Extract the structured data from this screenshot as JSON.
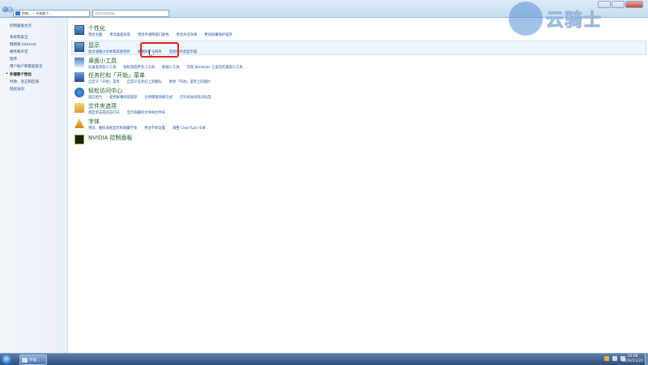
{
  "window": {
    "breadcrumb": [
      "控制...",
      "外观和个..."
    ],
    "search_placeholder": "搜索控制面板"
  },
  "watermark": {
    "text": "云骑士"
  },
  "sidebar": {
    "items": [
      {
        "label": "控制面板主页",
        "active": false
      },
      {
        "label": "系统和安全",
        "active": false
      },
      {
        "label": "网络和 Internet",
        "active": false
      },
      {
        "label": "硬件和声音",
        "active": false
      },
      {
        "label": "程序",
        "active": false
      },
      {
        "label": "用户帐户和家庭安全",
        "active": false
      },
      {
        "label": "外观和个性化",
        "active": true
      },
      {
        "label": "时钟、语言和区域",
        "active": false
      },
      {
        "label": "轻松访问",
        "active": false
      }
    ]
  },
  "categories": [
    {
      "title": "个性化",
      "icon": "monitor-icon",
      "links": [
        "更改主题",
        "更改桌面背景",
        "更改半透明窗口颜色",
        "更改声音效果",
        "更改屏幕保护程序"
      ]
    },
    {
      "title": "显示",
      "icon": "monitor-icon",
      "links": [
        "放大或缩小文本和其他项目",
        "调整屏幕分辨率",
        "连接到外部显示器"
      ]
    },
    {
      "title": "桌面小工具",
      "icon": "gadget-icon",
      "links": [
        "向桌面添加小工具",
        "联机获取更多小工具",
        "卸载小工具",
        "还原 Windows 上安装的桌面小工具"
      ]
    },
    {
      "title": "任务栏和「开始」菜单",
      "icon": "taskbar-icon",
      "links": [
        "自定义「开始」菜单",
        "自定义任务栏上的图标",
        "更改「开始」菜单上的图片"
      ]
    },
    {
      "title": "轻松访问中心",
      "icon": "ease-of-access-icon",
      "links": [
        "适应视力",
        "使用屏幕阅读程序",
        "启用键盘快捷方式",
        "打开或关闭高对比度"
      ]
    },
    {
      "title": "文件夹选项",
      "icon": "folder-icon",
      "links": [
        "指定单击或双击打开",
        "显示隐藏的文件和文件夹"
      ]
    },
    {
      "title": "字体",
      "icon": "font-icon",
      "links": [
        "预览、删除或者显示和隐藏字体",
        "更改字体设置",
        "调整 ClearType 文本"
      ]
    },
    {
      "title": "NVIDIA 控制面板",
      "icon": "nvidia-icon",
      "links": []
    }
  ],
  "taskbar": {
    "window_button": "外观...",
    "time": "16:08",
    "date": "2019/11/20"
  }
}
